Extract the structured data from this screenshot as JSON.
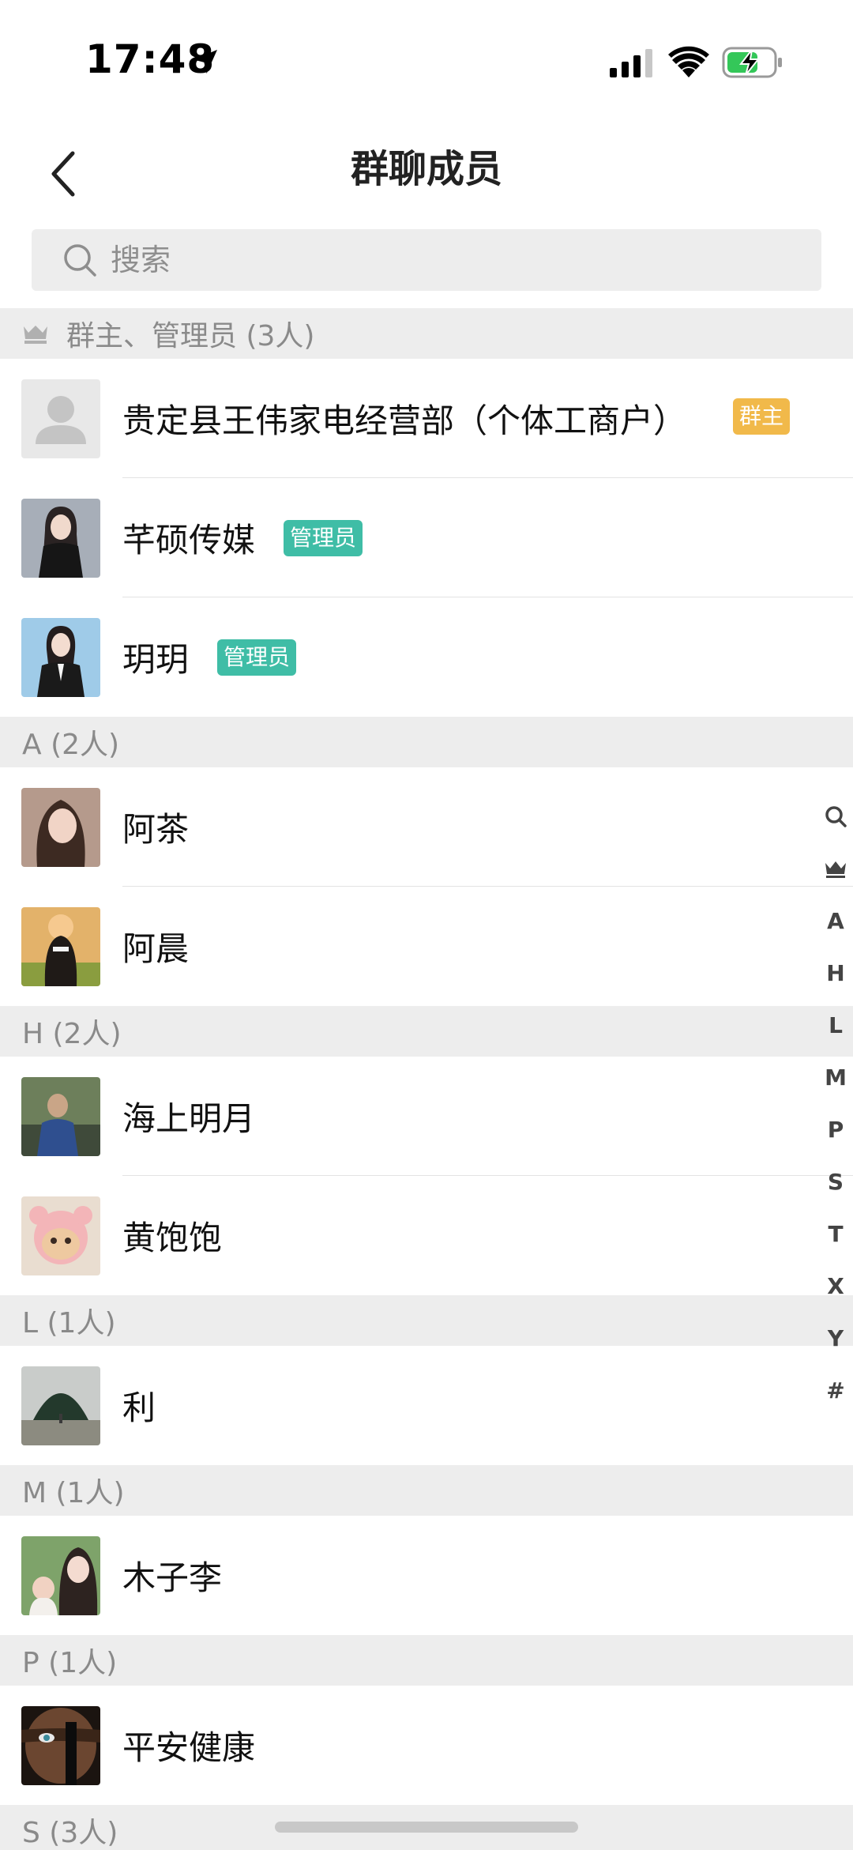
{
  "status_bar": {
    "time": "17:48"
  },
  "nav": {
    "title": "群聊成员"
  },
  "search": {
    "placeholder": "搜索"
  },
  "sections": {
    "admins": {
      "header": "群主、管理员 (3人)"
    },
    "a": {
      "header": "A (2人)"
    },
    "h": {
      "header": "H (2人)"
    },
    "l": {
      "header": "L (1人)"
    },
    "m": {
      "header": "M (1人)"
    },
    "p": {
      "header": "P (1人)"
    },
    "s": {
      "header": "S (3人)"
    }
  },
  "members": {
    "owner": {
      "name": "贵定县王伟家电经营部（个体工商户）",
      "badge": "群主"
    },
    "admin1": {
      "name": "芊硕传媒",
      "badge": "管理员"
    },
    "admin2": {
      "name": "玥玥",
      "badge": "管理员"
    },
    "a1": {
      "name": "阿茶"
    },
    "a2": {
      "name": "阿晨"
    },
    "h1": {
      "name": "海上明月"
    },
    "h2": {
      "name": "黄饱饱"
    },
    "l1": {
      "name": "利"
    },
    "m1": {
      "name": "木子李"
    },
    "p1": {
      "name": "平安健康"
    }
  },
  "index_bar": {
    "search_icon": "search-icon",
    "crown_icon": "crown-icon",
    "letters": [
      "A",
      "H",
      "L",
      "M",
      "P",
      "S",
      "T",
      "X",
      "Y",
      "#"
    ]
  },
  "colors": {
    "admin_badge": "#3fbda6",
    "owner_badge": "#f1b94a",
    "section_bg": "#ededed"
  }
}
